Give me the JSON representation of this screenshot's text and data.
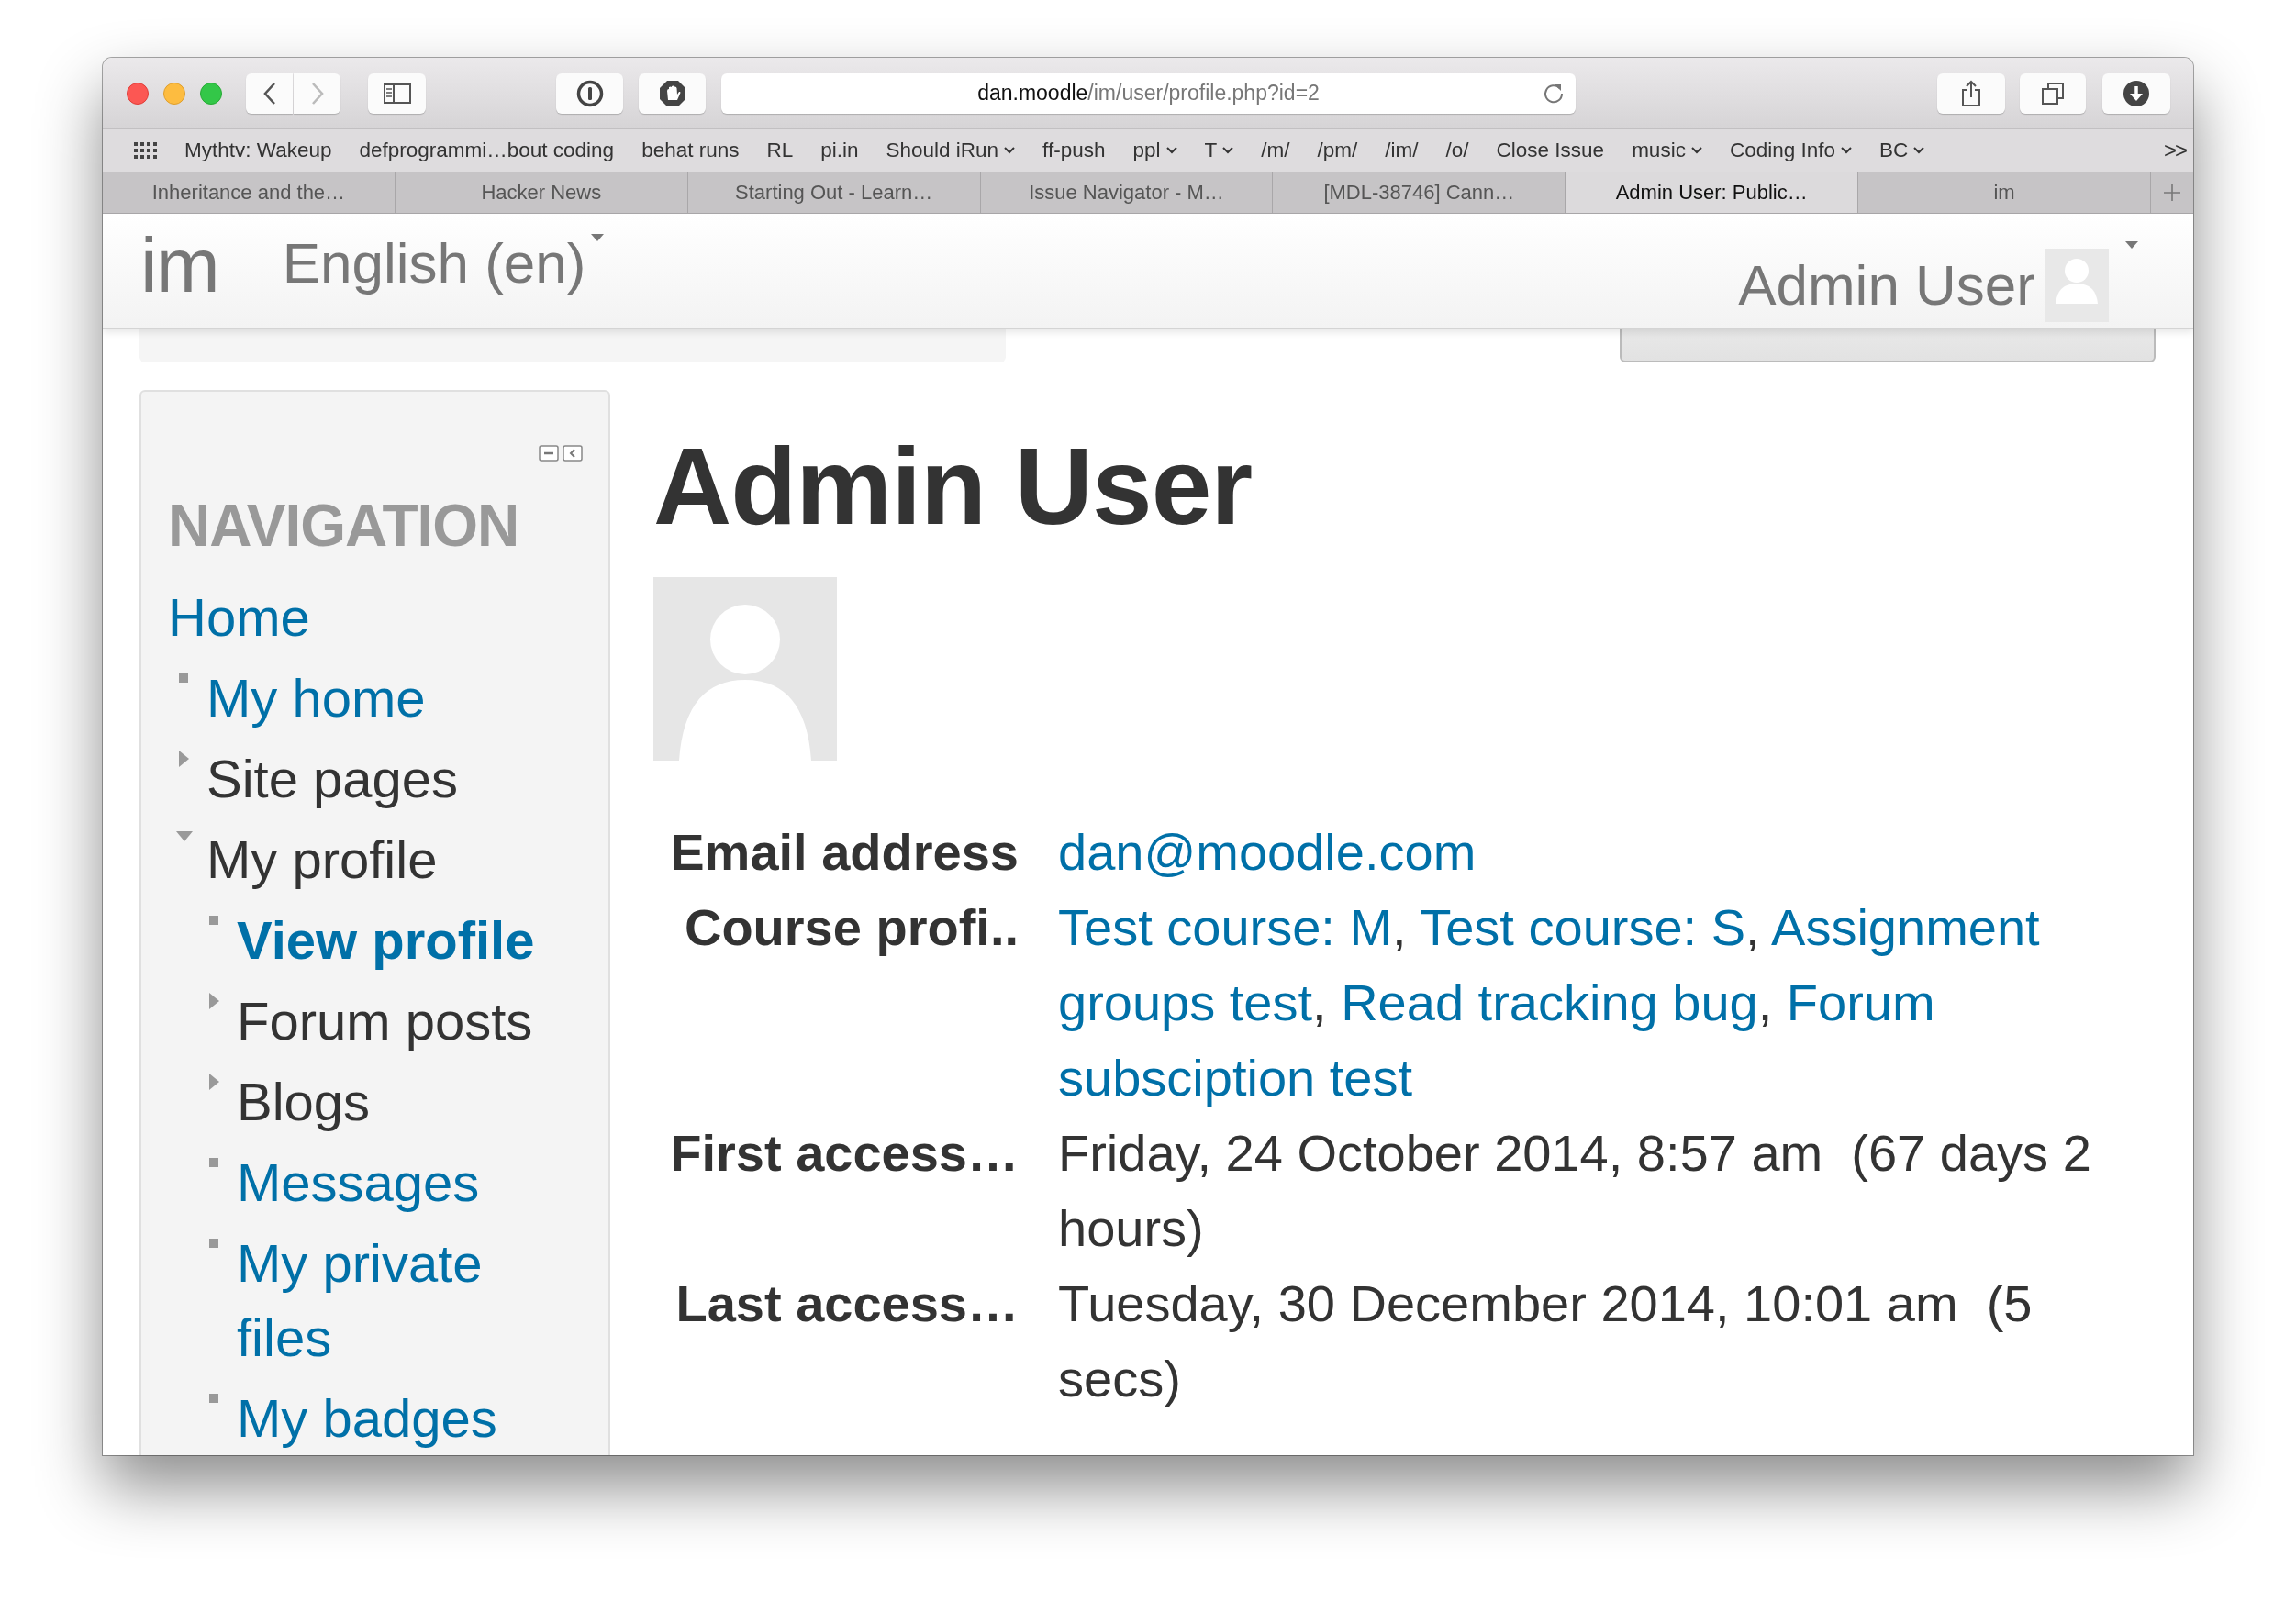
{
  "browser": {
    "url": {
      "host": "dan.moodle",
      "path": "/im/user/profile.php?id=2"
    },
    "bookmarks": [
      {
        "label": "Mythtv: Wakeup",
        "menu": false
      },
      {
        "label": "defprogrammi…bout coding",
        "menu": false
      },
      {
        "label": "behat runs",
        "menu": false
      },
      {
        "label": "RL",
        "menu": false
      },
      {
        "label": "pi.in",
        "menu": false
      },
      {
        "label": "Should iRun",
        "menu": true
      },
      {
        "label": "ff-push",
        "menu": false
      },
      {
        "label": "ppl",
        "menu": true
      },
      {
        "label": "T",
        "menu": true
      },
      {
        "label": "/m/",
        "menu": false
      },
      {
        "label": "/pm/",
        "menu": false
      },
      {
        "label": "/im/",
        "menu": false
      },
      {
        "label": "/o/",
        "menu": false
      },
      {
        "label": "Close Issue",
        "menu": false
      },
      {
        "label": "music",
        "menu": true
      },
      {
        "label": "Coding Info",
        "menu": true
      },
      {
        "label": "BC",
        "menu": true
      }
    ],
    "bookmarks_overflow": ">>",
    "tabs": [
      {
        "label": "Inheritance and the…",
        "selected": false
      },
      {
        "label": "Hacker News",
        "selected": false
      },
      {
        "label": "Starting Out - Learn…",
        "selected": false
      },
      {
        "label": "Issue Navigator - M…",
        "selected": false
      },
      {
        "label": "[MDL-38746] Cann…",
        "selected": false
      },
      {
        "label": "Admin User: Public…",
        "selected": true
      },
      {
        "label": "im",
        "selected": false
      }
    ]
  },
  "header": {
    "site_name": "im",
    "language": "English (en)",
    "user_name": "Admin User"
  },
  "navigation": {
    "title": "NAVIGATION",
    "items": [
      {
        "label": "Home",
        "kind": "branch",
        "link": true,
        "selected": false,
        "children": [
          {
            "label": "My home",
            "kind": "leaf",
            "link": true,
            "selected": false
          },
          {
            "label": "Site pages",
            "kind": "branch",
            "expanded": false,
            "link": false,
            "selected": false
          },
          {
            "label": "My profile",
            "kind": "branch",
            "expanded": true,
            "link": false,
            "selected": false,
            "children": [
              {
                "label": "View profile",
                "kind": "leaf",
                "link": true,
                "selected": true
              },
              {
                "label": "Forum posts",
                "kind": "branch",
                "expanded": false,
                "link": false,
                "selected": false
              },
              {
                "label": "Blogs",
                "kind": "branch",
                "expanded": false,
                "link": false,
                "selected": false
              },
              {
                "label": "Messages",
                "kind": "leaf",
                "link": true,
                "selected": false
              },
              {
                "label": "My private files",
                "kind": "leaf",
                "link": true,
                "selected": false
              },
              {
                "label": "My badges",
                "kind": "leaf",
                "link": true,
                "selected": false
              }
            ]
          }
        ]
      }
    ]
  },
  "profile": {
    "name": "Admin User",
    "fields": [
      {
        "label": "Email address",
        "kind": "link",
        "value": "dan@moodle.com"
      },
      {
        "label": "Course profi..",
        "kind": "links",
        "separator": ", ",
        "values": [
          "Test course: M",
          "Test course: S",
          "Assignment groups test",
          "Read tracking bug",
          "Forum subsciption test"
        ]
      },
      {
        "label": "First access…",
        "kind": "text",
        "value": "Friday, 24 October 2014, 8:57 am  (67 days 2 hours)"
      },
      {
        "label": "Last access…",
        "kind": "text",
        "value": "Tuesday, 30 December 2014, 10:01 am  (5 secs)"
      }
    ]
  }
}
